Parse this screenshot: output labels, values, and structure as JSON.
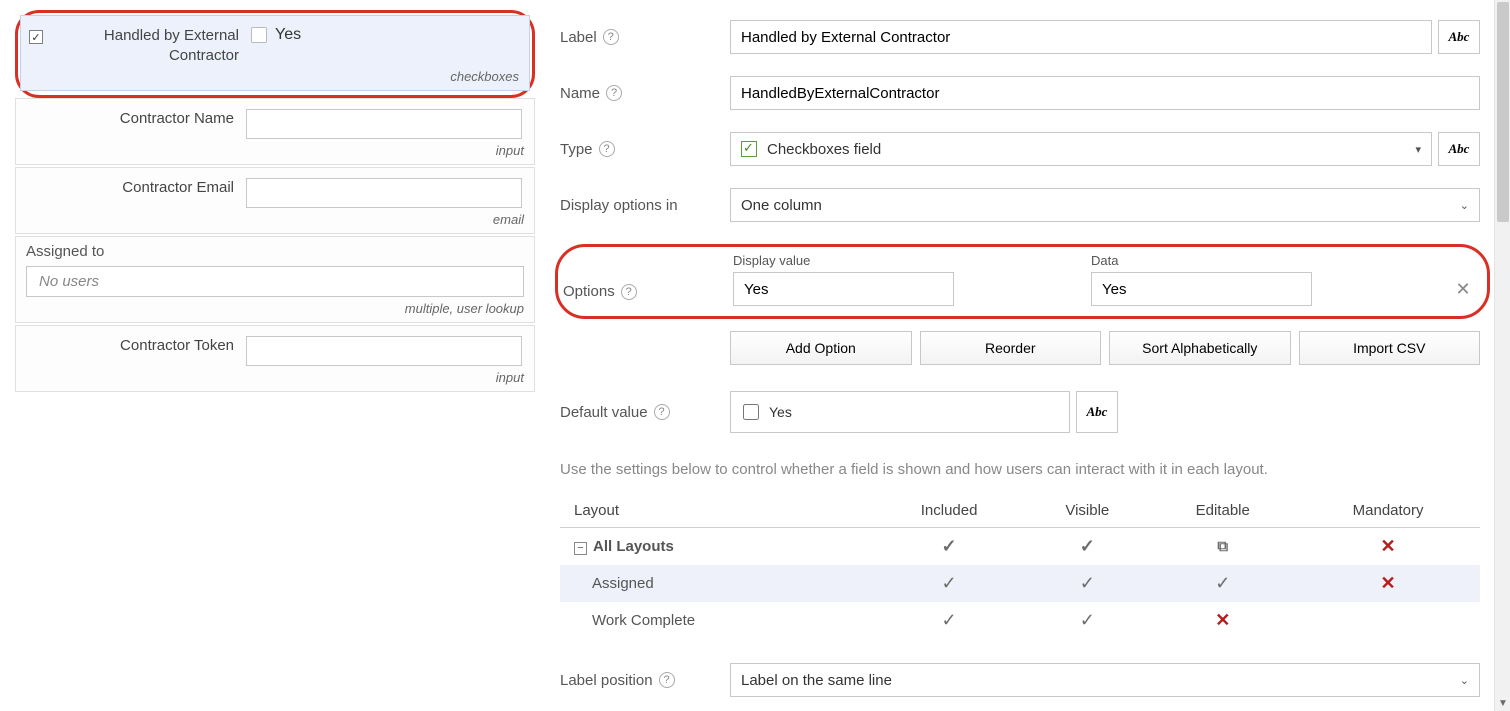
{
  "left": {
    "fields": [
      {
        "label": "Handled by External Contractor",
        "option_text": "Yes",
        "type_tag": "checkboxes",
        "selected": true
      },
      {
        "label": "Contractor Name",
        "type_tag": "input"
      },
      {
        "label": "Contractor Email",
        "type_tag": "email"
      },
      {
        "label": "Assigned to",
        "placeholder": "No users",
        "type_tag": "multiple, user lookup"
      },
      {
        "label": "Contractor Token",
        "type_tag": "input"
      }
    ]
  },
  "right": {
    "label_field_label": "Label",
    "label_value": "Handled by External Contractor",
    "name_field_label": "Name",
    "name_value": "HandledByExternalContractor",
    "type_field_label": "Type",
    "type_value": "Checkboxes field",
    "display_options_label": "Display options in",
    "display_options_value": "One column",
    "options_label": "Options",
    "option_display_header": "Display value",
    "option_data_header": "Data",
    "option_display_value": "Yes",
    "option_data_value": "Yes",
    "buttons": {
      "add_option": "Add Option",
      "reorder": "Reorder",
      "sort_alpha": "Sort Alphabetically",
      "import_csv": "Import CSV"
    },
    "default_value_label": "Default value",
    "default_value_option": "Yes",
    "abc_label": "Abc",
    "layout_help": "Use the settings below to control whether a field is shown and how users can interact with it in each layout.",
    "layout_table": {
      "headers": [
        "Layout",
        "Included",
        "Visible",
        "Editable",
        "Mandatory"
      ],
      "rows": [
        {
          "name": "All Layouts",
          "included": "check",
          "visible": "check",
          "editable": "copy",
          "mandatory": "x",
          "all": true
        },
        {
          "name": "Assigned",
          "included": "check",
          "visible": "check",
          "editable": "check",
          "mandatory": "x"
        },
        {
          "name": "Work Complete",
          "included": "check",
          "visible": "check",
          "editable": "x",
          "mandatory": ""
        }
      ]
    },
    "label_position_label": "Label position",
    "label_position_value": "Label on the same line"
  }
}
